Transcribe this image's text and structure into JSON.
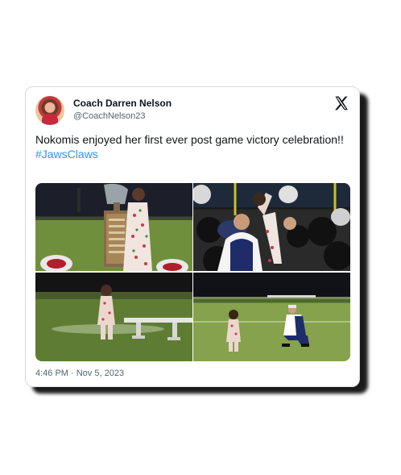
{
  "tweet": {
    "author_name": "Coach Darren Nelson",
    "author_handle": "@CoachNelson23",
    "text": "Nokomis enjoyed her first ever post game victory celebration!!",
    "hashtag": "#JawsClaws",
    "timestamp": "4:46 PM · Nov 5, 2023",
    "platform_icon": "x-logo-icon",
    "avatar_icon": "avatar-photo"
  },
  "photos": [
    {
      "name": "trophy-photo"
    },
    {
      "name": "team-celebration-photo"
    },
    {
      "name": "field-bench-photo"
    },
    {
      "name": "coach-kneeling-photo"
    }
  ],
  "colors": {
    "text": "#0f1419",
    "secondary": "#536471",
    "hashtag": "#1d9bf0",
    "card_shadow": "#1a1a1a"
  }
}
